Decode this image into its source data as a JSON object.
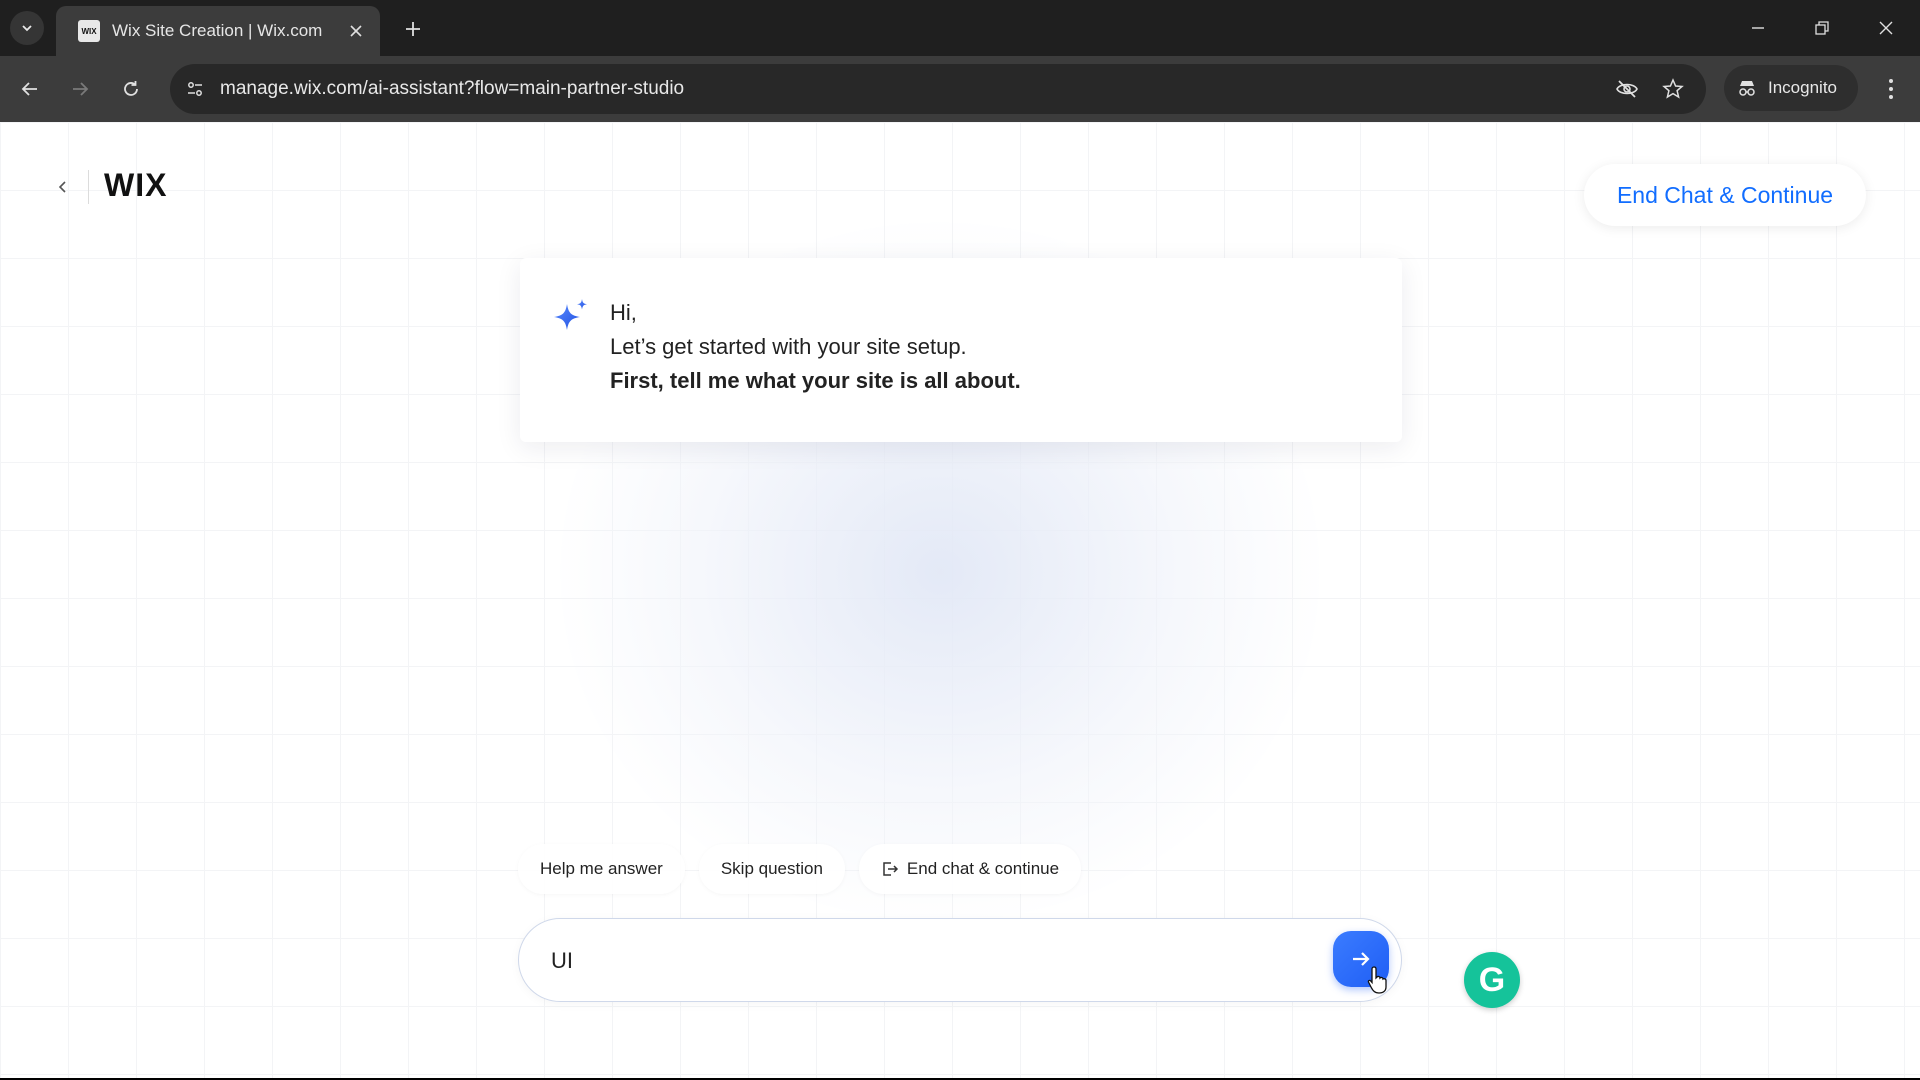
{
  "browser": {
    "tab_title": "Wix Site Creation | Wix.com",
    "favicon_text": "WIX",
    "url": "manage.wix.com/ai-assistant?flow=main-partner-studio",
    "profile_label": "Incognito"
  },
  "header": {
    "logo": "WIX",
    "end_chat_label": "End Chat & Continue"
  },
  "assistant_message": {
    "greeting": "Hi,",
    "line": "Let’s get started with your site setup.",
    "prompt": "First, tell me what your site is all about."
  },
  "chips": {
    "help": "Help me answer",
    "skip": "Skip question",
    "end": "End chat & continue"
  },
  "composer": {
    "value": "UI"
  },
  "colors": {
    "accent": "#116dff",
    "send": "#1f5ef5",
    "grammarly": "#15c39a"
  },
  "icons": [
    "tab-list-icon",
    "close-icon",
    "plus-icon",
    "back-arrow-icon",
    "forward-arrow-icon",
    "reload-icon",
    "site-info-icon",
    "eye-off-icon",
    "star-icon",
    "incognito-icon",
    "kebab-menu-icon",
    "chevron-left-icon",
    "sparkle-icon",
    "exit-icon",
    "arrow-right-icon",
    "hand-cursor-icon",
    "grammarly-icon"
  ]
}
